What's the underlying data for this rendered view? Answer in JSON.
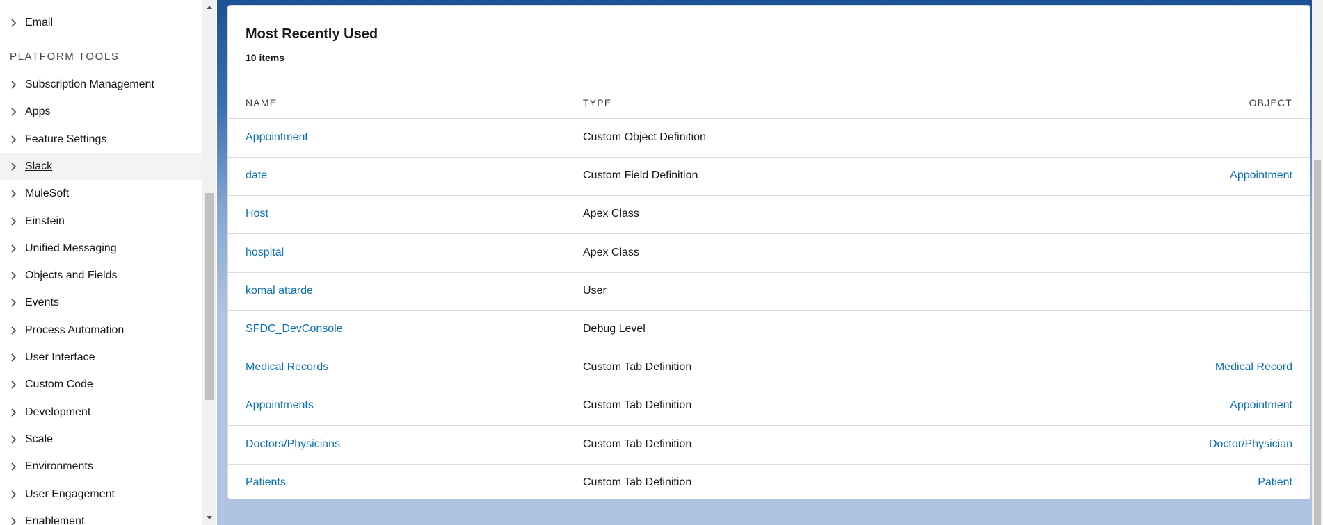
{
  "sidebar": {
    "items_top": [
      {
        "label": "Email"
      }
    ],
    "section_title": "PLATFORM TOOLS",
    "items": [
      {
        "label": "Subscription Management"
      },
      {
        "label": "Apps"
      },
      {
        "label": "Feature Settings"
      },
      {
        "label": "Slack"
      },
      {
        "label": "MuleSoft"
      },
      {
        "label": "Einstein"
      },
      {
        "label": "Unified Messaging"
      },
      {
        "label": "Objects and Fields"
      },
      {
        "label": "Events"
      },
      {
        "label": "Process Automation"
      },
      {
        "label": "User Interface"
      },
      {
        "label": "Custom Code"
      },
      {
        "label": "Development"
      },
      {
        "label": "Scale"
      },
      {
        "label": "Environments"
      },
      {
        "label": "User Engagement"
      },
      {
        "label": "Enablement"
      }
    ],
    "active_item": "Slack"
  },
  "recent": {
    "title": "Most Recently Used",
    "count": "10 items",
    "columns": {
      "name": "NAME",
      "type": "TYPE",
      "object": "OBJECT"
    },
    "rows": [
      {
        "name": "Appointment",
        "type": "Custom Object Definition",
        "object": ""
      },
      {
        "name": "date",
        "type": "Custom Field Definition",
        "object": "Appointment"
      },
      {
        "name": "Host",
        "type": "Apex Class",
        "object": ""
      },
      {
        "name": "hospital",
        "type": "Apex Class",
        "object": ""
      },
      {
        "name": "komal attarde",
        "type": "User",
        "object": ""
      },
      {
        "name": "SFDC_DevConsole",
        "type": "Debug Level",
        "object": ""
      },
      {
        "name": "Medical Records",
        "type": "Custom Tab Definition",
        "object": "Medical Record"
      },
      {
        "name": "Appointments",
        "type": "Custom Tab Definition",
        "object": "Appointment"
      },
      {
        "name": "Doctors/Physicians",
        "type": "Custom Tab Definition",
        "object": "Doctor/Physician"
      },
      {
        "name": "Patients",
        "type": "Custom Tab Definition",
        "object": "Patient"
      }
    ]
  },
  "colors": {
    "link": "#0b6fb8",
    "text": "#181818",
    "border": "#dddbda",
    "background_blue": "#1b5297"
  },
  "icons": {
    "chevron": "chevron-right-icon",
    "scroll_up": "scroll-up-arrow-icon",
    "scroll_down": "scroll-down-arrow-icon"
  }
}
